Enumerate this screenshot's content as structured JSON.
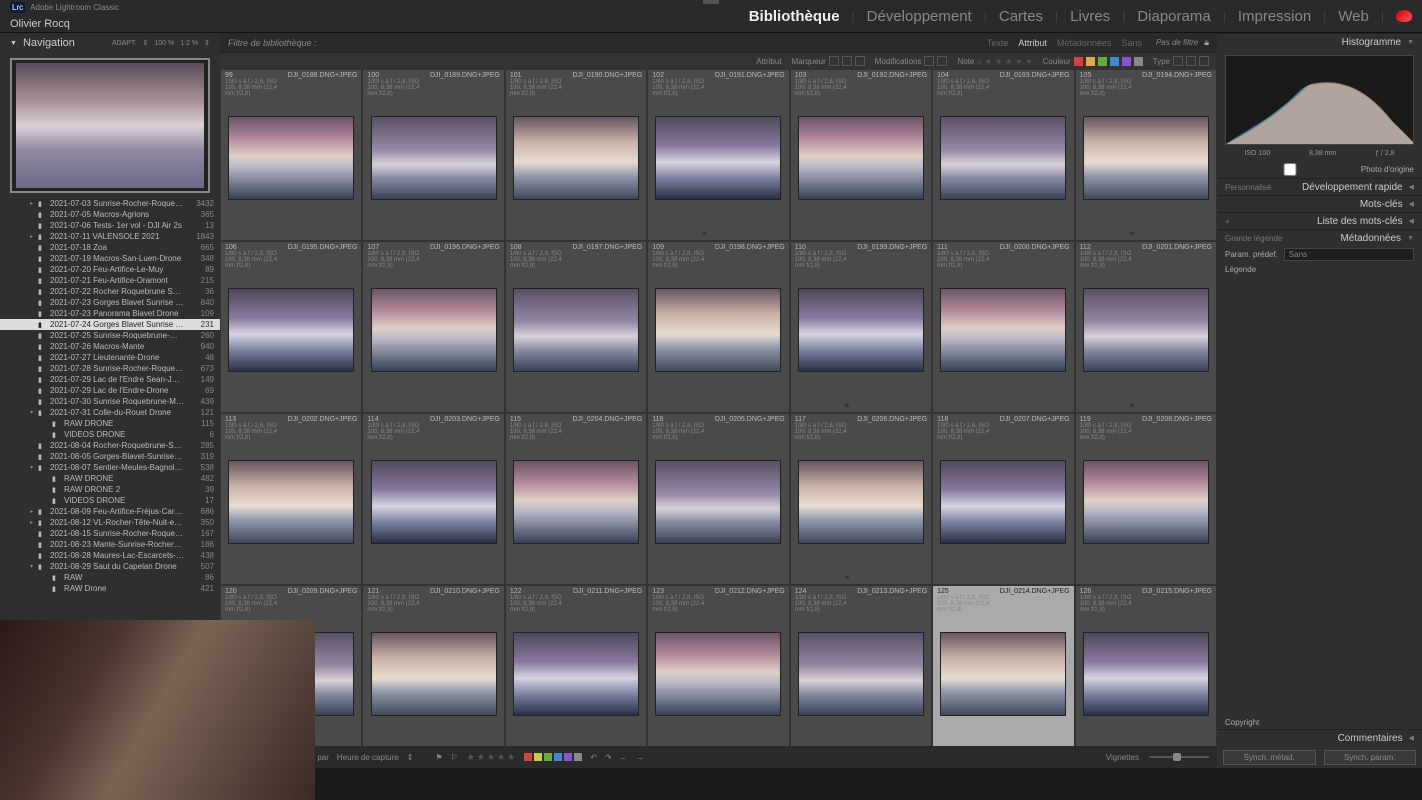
{
  "app": {
    "logo_text": "Lrc",
    "title": "Adobe Lightroom Classic",
    "user": "Olivier Rocq"
  },
  "modules": {
    "library": "Bibliothèque",
    "develop": "Développement",
    "map": "Cartes",
    "book": "Livres",
    "slideshow": "Diaporama",
    "print": "Impression",
    "web": "Web",
    "active": "library"
  },
  "left": {
    "nav_title": "Navigation",
    "adapt_label": "ADAPT.",
    "zoom_pct": "100 %",
    "zoom_ratio": "1:2 %",
    "folders": [
      {
        "tri": "▸",
        "name": "2021-07-03 Sunrise-Rocher-Roquebrune…",
        "count": "3432"
      },
      {
        "tri": "",
        "name": "2021-07-05 Macros-Agrions",
        "count": "365"
      },
      {
        "tri": "",
        "name": "2021-07-06 Tests- 1er vol - DJI Air 2s",
        "count": "13"
      },
      {
        "tri": "▸",
        "name": "2021-07-11 VALENSOLE 2021",
        "count": "1843"
      },
      {
        "tri": "",
        "name": "2021-07-18 Zoa",
        "count": "665"
      },
      {
        "tri": "",
        "name": "2021-07-19 Macros-San-Luen-Drone",
        "count": "348"
      },
      {
        "tri": "",
        "name": "2021-07-20 Feu-Artifice-Le-Muy",
        "count": "89"
      },
      {
        "tri": "",
        "name": "2021-07-21 Feu-Artifice-Oramont",
        "count": "215"
      },
      {
        "tri": "",
        "name": "2021-07-22 Rocher Roquebrune Sunset",
        "count": "36"
      },
      {
        "tri": "",
        "name": "2021-07-23 Gorges Blavet Sunrise - Macros…",
        "count": "840"
      },
      {
        "tri": "",
        "name": "2021-07-23 Panorama Blavet Drone",
        "count": "109"
      },
      {
        "tri": "",
        "name": "2021-07-24 Gorges Blavet Sunrise Drone",
        "count": "231",
        "sel": true
      },
      {
        "tri": "",
        "name": "2021-07-25 Sunrise-Roquebrune-Macros-…",
        "count": "260"
      },
      {
        "tri": "",
        "name": "2021-07-26 Macros-Mante",
        "count": "940"
      },
      {
        "tri": "",
        "name": "2021-07-27 Lieutenante-Drone",
        "count": "48"
      },
      {
        "tri": "",
        "name": "2021-07-28 Sunrise-Rocher-Roquebrune-M…",
        "count": "673"
      },
      {
        "tri": "",
        "name": "2021-07-29 Lac de l'Endre Sean-Jade - Mac…",
        "count": "149"
      },
      {
        "tri": "",
        "name": "2021-07-29 Lac de l'Endre-Drone",
        "count": "69"
      },
      {
        "tri": "",
        "name": "2021-07-30 Sunrise Roquebrune-Monaster…",
        "count": "439"
      },
      {
        "tri": "▾",
        "name": "2021-07-31 Colle-du-Rouet Drone",
        "count": "121"
      },
      {
        "tri": "",
        "name": "RAW DRONE",
        "count": "115",
        "sub": 1
      },
      {
        "tri": "",
        "name": "VIDEOS DRONE",
        "count": "6",
        "sub": 1
      },
      {
        "tri": "",
        "name": "2021-08-04 Rocher-Roquebrune-Sunset-D…",
        "count": "285"
      },
      {
        "tri": "",
        "name": "2021-08-05 Gorges-Blavet-Sunrise-Drone",
        "count": "319"
      },
      {
        "tri": "▾",
        "name": "2021-08-07 Sentier-Meules-Bagnols-Drone",
        "count": "538"
      },
      {
        "tri": "",
        "name": "RAW DRONE",
        "count": "482",
        "sub": 1
      },
      {
        "tri": "",
        "name": "RAW DRONE 2",
        "count": "39",
        "sub": 1
      },
      {
        "tri": "",
        "name": "VIDEOS DRONE",
        "count": "17",
        "sub": 1
      },
      {
        "tri": "▸",
        "name": "2021-08-09 Feu-Artifice-Fréjus-Carrousel",
        "count": "686"
      },
      {
        "tri": "▸",
        "name": "2021-08-12 VL-Rocher-Tête-Nuit-etoiles-Bl…",
        "count": "350"
      },
      {
        "tri": "",
        "name": "2021-08-15 Sunrise-Rocher-Roquebrune-D…",
        "count": "167"
      },
      {
        "tri": "",
        "name": "2021-08-23 Mante-Sunrise-Rocher-Maures…",
        "count": "186"
      },
      {
        "tri": "",
        "name": "2021-08-28 Maures-Lac-Escarcets-Incendi…",
        "count": "438"
      },
      {
        "tri": "▾",
        "name": "2021-08-29 Saut du Capelan Drone",
        "count": "507"
      },
      {
        "tri": "",
        "name": "RAW",
        "count": "86",
        "sub": 1
      },
      {
        "tri": "",
        "name": "RAW Drone",
        "count": "421",
        "sub": 1
      }
    ]
  },
  "filter_bar": {
    "label": "Filtre de bibliothèque :",
    "tabs": {
      "text": "Texte",
      "attr": "Attribut",
      "meta": "Métadonnées",
      "none": "Sans"
    },
    "end": "Pas de filtre"
  },
  "attr_bar": {
    "attribut": "Attribut",
    "marqueur": "Marqueur",
    "modifications": "Modifications",
    "note": "Note",
    "couleur": "Couleur",
    "type": "Type",
    "colors": [
      "#c44",
      "#da5",
      "#6a4",
      "#48c",
      "#85c",
      "#888"
    ]
  },
  "grid": {
    "meta_line": "1/80 s à f / 2,8, ISO 100, 8,38 mm (22,4 mm f/2,8)",
    "cells": [
      {
        "idx": "99",
        "file": "DJI_0188.DNG+JPEG",
        "star": 0
      },
      {
        "idx": "100",
        "file": "DJI_0189.DNG+JPEG",
        "star": 0
      },
      {
        "idx": "101",
        "file": "DJI_0190.DNG+JPEG",
        "star": 0
      },
      {
        "idx": "102",
        "file": "DJI_0191.DNG+JPEG",
        "star": 1
      },
      {
        "idx": "103",
        "file": "DJI_0192.DNG+JPEG",
        "star": 0
      },
      {
        "idx": "104",
        "file": "DJI_0193.DNG+JPEG",
        "star": 0
      },
      {
        "idx": "105",
        "file": "DJI_0194.DNG+JPEG",
        "star": 1
      },
      {
        "idx": "106",
        "file": "DJI_0195.DNG+JPEG",
        "star": 0
      },
      {
        "idx": "107",
        "file": "DJI_0196.DNG+JPEG",
        "star": 0
      },
      {
        "idx": "108",
        "file": "DJI_0197.DNG+JPEG",
        "star": 0
      },
      {
        "idx": "109",
        "file": "DJI_0198.DNG+JPEG",
        "star": 0
      },
      {
        "idx": "110",
        "file": "DJI_0199.DNG+JPEG",
        "star": 1
      },
      {
        "idx": "111",
        "file": "DJI_0200.DNG+JPEG",
        "star": 0
      },
      {
        "idx": "112",
        "file": "DJI_0201.DNG+JPEG",
        "star": 1
      },
      {
        "idx": "113",
        "file": "DJI_0202.DNG+JPEG",
        "star": 0
      },
      {
        "idx": "114",
        "file": "DJI_0203.DNG+JPEG",
        "star": 0
      },
      {
        "idx": "115",
        "file": "DJI_0204.DNG+JPEG",
        "star": 0
      },
      {
        "idx": "116",
        "file": "DJI_0205.DNG+JPEG",
        "star": 0
      },
      {
        "idx": "117",
        "file": "DJI_0206.DNG+JPEG",
        "star": 1
      },
      {
        "idx": "118",
        "file": "DJI_0207.DNG+JPEG",
        "star": 0
      },
      {
        "idx": "119",
        "file": "DJI_0208.DNG+JPEG",
        "star": 0
      },
      {
        "idx": "120",
        "file": "DJI_0209.DNG+JPEG",
        "star": 0
      },
      {
        "idx": "121",
        "file": "DJI_0210.DNG+JPEG",
        "star": 0
      },
      {
        "idx": "122",
        "file": "DJI_0211.DNG+JPEG",
        "star": 0
      },
      {
        "idx": "123",
        "file": "DJI_0212.DNG+JPEG",
        "star": 0
      },
      {
        "idx": "124",
        "file": "DJI_0213.DNG+JPEG",
        "star": 0
      },
      {
        "idx": "125",
        "file": "DJI_0214.DNG+JPEG",
        "star": 1,
        "sel": true
      },
      {
        "idx": "126",
        "file": "DJI_0215.DNG+JPEG",
        "star": 0
      }
    ],
    "gradients": [
      "linear-gradient(180deg,#6a5565 0%,#b0859a 25%,#e0d0c8 48%,#b5b5c5 62%,#354055 100%)",
      "linear-gradient(180deg,#5a5065 0%,#9588a5 40%,#d8d0d8 58%,#858aa0 75%,#3a4055 100%)",
      "linear-gradient(180deg,#655565 0%,#c8b0a5 30%,#e8dcd0 55%,#9098ac 72%,#404858 100%)",
      "linear-gradient(180deg,#504858 0%,#8878a0 35%,#d8d4e0 55%,#7a80a0 75%,#2a3045 100%)"
    ]
  },
  "right": {
    "histogram": "Histogramme",
    "histo_info": {
      "iso": "ISO 100",
      "focal": "8,38 mm",
      "aperture": "ƒ / 2,8"
    },
    "origin_chk": "Photo d'origine",
    "personnalise": "Personnalisé",
    "quick_dev": "Développement rapide",
    "keywords": "Mots-clés",
    "keyword_list": "Liste des mots-clés",
    "grande_legende": "Grande légende",
    "metadata": "Métadonnées",
    "param_predef": "Param. prédef.",
    "param_value": "Sans",
    "legende": "Légende",
    "copyright": "Copyright",
    "comments": "Commentaires"
  },
  "bottom": {
    "sort_label": "Tri par",
    "sort_value": "Heure de capture",
    "swatch_colors": [
      "#c44",
      "#cc4",
      "#6a4",
      "#48c",
      "#85c",
      "#888"
    ],
    "thumbnails": "Vignettes",
    "sync_meta": "Synch. métad.",
    "sync_param": "Synch. param."
  }
}
